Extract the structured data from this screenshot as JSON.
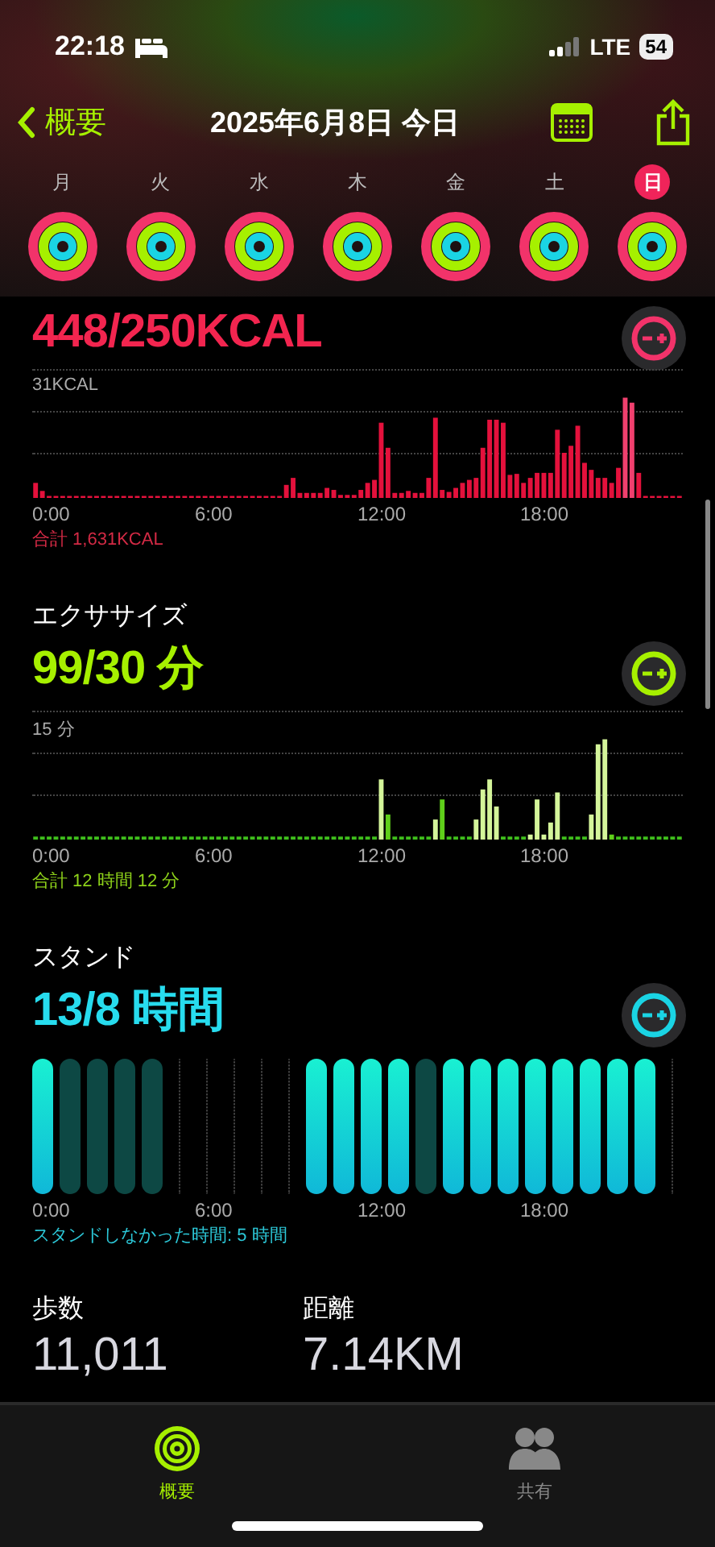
{
  "status_bar": {
    "time": "22:18",
    "network": "LTE",
    "battery": "54"
  },
  "nav": {
    "back": "概要",
    "title": "2025年6月8日 今日"
  },
  "days": [
    {
      "label": "月",
      "selected": false
    },
    {
      "label": "火",
      "selected": false
    },
    {
      "label": "水",
      "selected": false
    },
    {
      "label": "木",
      "selected": false
    },
    {
      "label": "金",
      "selected": false
    },
    {
      "label": "土",
      "selected": false
    },
    {
      "label": "日",
      "selected": true
    }
  ],
  "move": {
    "value": "448/250KCAL",
    "max_label": "31KCAL",
    "x_labels": [
      "0:00",
      "6:00",
      "12:00",
      "18:00"
    ],
    "total": "合計 1,631KCAL"
  },
  "exercise": {
    "title": "エクササイズ",
    "value": "99/30 分",
    "max_label": "15 分",
    "x_labels": [
      "0:00",
      "6:00",
      "12:00",
      "18:00"
    ],
    "total": "合計 12 時間 12 分"
  },
  "stand": {
    "title": "スタンド",
    "value": "13/8 時間",
    "hours": [
      {
        "kind": "stood"
      },
      {
        "kind": "missed"
      },
      {
        "kind": "missed"
      },
      {
        "kind": "missed"
      },
      {
        "kind": "missed"
      },
      {
        "kind": "none"
      },
      {
        "kind": "none"
      },
      {
        "kind": "none"
      },
      {
        "kind": "none"
      },
      {
        "kind": "none"
      },
      {
        "kind": "stood"
      },
      {
        "kind": "stood"
      },
      {
        "kind": "stood"
      },
      {
        "kind": "stood"
      },
      {
        "kind": "missed"
      },
      {
        "kind": "stood"
      },
      {
        "kind": "stood"
      },
      {
        "kind": "stood"
      },
      {
        "kind": "stood"
      },
      {
        "kind": "stood"
      },
      {
        "kind": "stood"
      },
      {
        "kind": "stood"
      },
      {
        "kind": "stood"
      },
      {
        "kind": "none"
      }
    ],
    "x_labels": [
      "0:00",
      "6:00",
      "12:00",
      "18:00"
    ],
    "note": "スタンドしなかった時間: 5 時間"
  },
  "stats": [
    {
      "label": "歩数",
      "value": "11,011"
    },
    {
      "label": "距離",
      "value": "7.14KM"
    }
  ],
  "tabs": [
    {
      "label": "概要",
      "selected": true
    },
    {
      "label": "共有",
      "selected": false
    }
  ]
}
